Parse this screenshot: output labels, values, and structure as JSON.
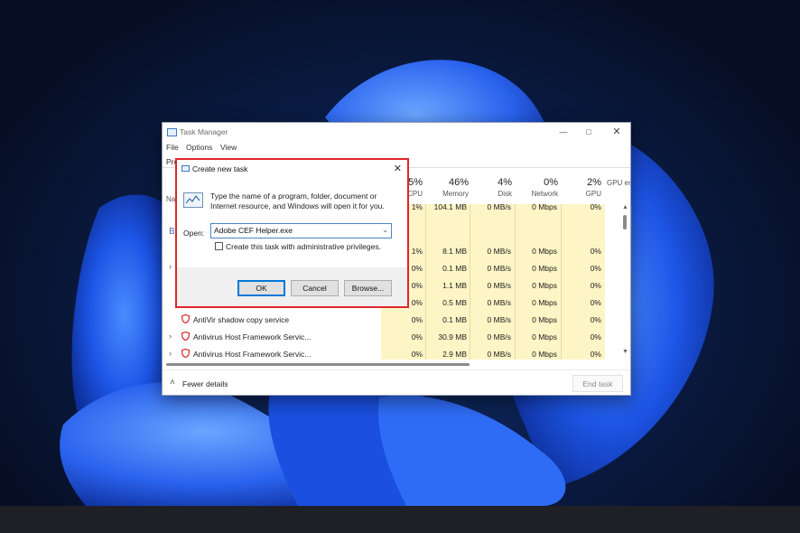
{
  "task_manager": {
    "title": "Task Manager",
    "menu": [
      "File",
      "Options",
      "View"
    ],
    "tab_fragment": "Pro",
    "name_col_fragment": "Na",
    "columns": [
      {
        "pct": "5%",
        "label": "CPU"
      },
      {
        "pct": "46%",
        "label": "Memory"
      },
      {
        "pct": "4%",
        "label": "Disk"
      },
      {
        "pct": "0%",
        "label": "Network"
      },
      {
        "pct": "2%",
        "label": "GPU"
      },
      {
        "pct": "",
        "label": "GPU en"
      }
    ],
    "rows": [
      {
        "name": "",
        "cpu": "1%",
        "memory": "104.1 MB",
        "disk": "0 MB/s",
        "network": "0 Mbps",
        "gpu": "0%"
      },
      {
        "name": "",
        "cpu": "",
        "memory": "",
        "disk": "",
        "network": "",
        "gpu": ""
      },
      {
        "name": "",
        "cpu": "1%",
        "memory": "8.1 MB",
        "disk": "0 MB/s",
        "network": "0 Mbps",
        "gpu": "0%"
      },
      {
        "name": "",
        "cpu": "0%",
        "memory": "0.1 MB",
        "disk": "0 MB/s",
        "network": "0 Mbps",
        "gpu": "0%"
      },
      {
        "name": "",
        "cpu": "0%",
        "memory": "1.1 MB",
        "disk": "0 MB/s",
        "network": "0 Mbps",
        "gpu": "0%"
      },
      {
        "name": "",
        "cpu": "0%",
        "memory": "0.5 MB",
        "disk": "0 MB/s",
        "network": "0 Mbps",
        "gpu": "0%"
      },
      {
        "name": "AntiVir shadow copy service",
        "cpu": "0%",
        "memory": "0.1 MB",
        "disk": "0 MB/s",
        "network": "0 Mbps",
        "gpu": "0%"
      },
      {
        "name": "Antivirus Host Framework Servic...",
        "cpu": "0%",
        "memory": "30.9 MB",
        "disk": "0 MB/s",
        "network": "0 Mbps",
        "gpu": "0%"
      },
      {
        "name": "Antivirus Host Framework Servic...",
        "cpu": "0%",
        "memory": "2.9 MB",
        "disk": "0 MB/s",
        "network": "0 Mbps",
        "gpu": "0%"
      }
    ],
    "group_letter": "B",
    "fewer_details": "Fewer details",
    "end_task": "End task"
  },
  "dialog": {
    "title": "Create new task",
    "description": "Type the name of a program, folder, document or Internet resource, and Windows will open it for you.",
    "open_label": "Open:",
    "open_value": "Adobe CEF Helper.exe",
    "admin_checkbox_label": "Create this task with administrative privileges.",
    "admin_checked": false,
    "ok": "OK",
    "cancel": "Cancel",
    "browse": "Browse..."
  },
  "colors": {
    "highlight_border": "#e0262b",
    "heat_fill": "#fdf5c6",
    "accent": "#0078d7"
  }
}
